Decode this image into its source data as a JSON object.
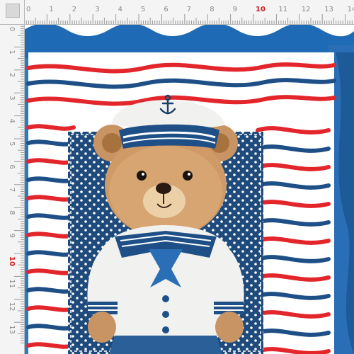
{
  "ruler": {
    "horizontal_labels": [
      "0",
      "1",
      "2",
      "3",
      "4",
      "5",
      "6",
      "7",
      "8",
      "9",
      "10",
      "11",
      "12",
      "13",
      "14"
    ],
    "vertical_labels": [
      "0",
      "1",
      "2",
      "3",
      "4",
      "5",
      "6",
      "7",
      "8",
      "9",
      "10",
      "11",
      "12",
      "13"
    ],
    "highlight_label": "10",
    "label_color": "#8a8a8a",
    "highlight_color": "#d11a1a"
  },
  "artwork": {
    "subject": "sailor teddy bear",
    "icons": [
      "anchor-icon"
    ],
    "colors": {
      "navy": "#1e4f86",
      "blue": "#2a6fb5",
      "red": "#e2262b",
      "white": "#ffffff",
      "fur": "#c99463",
      "sailor_white": "#f1f1ef"
    }
  }
}
